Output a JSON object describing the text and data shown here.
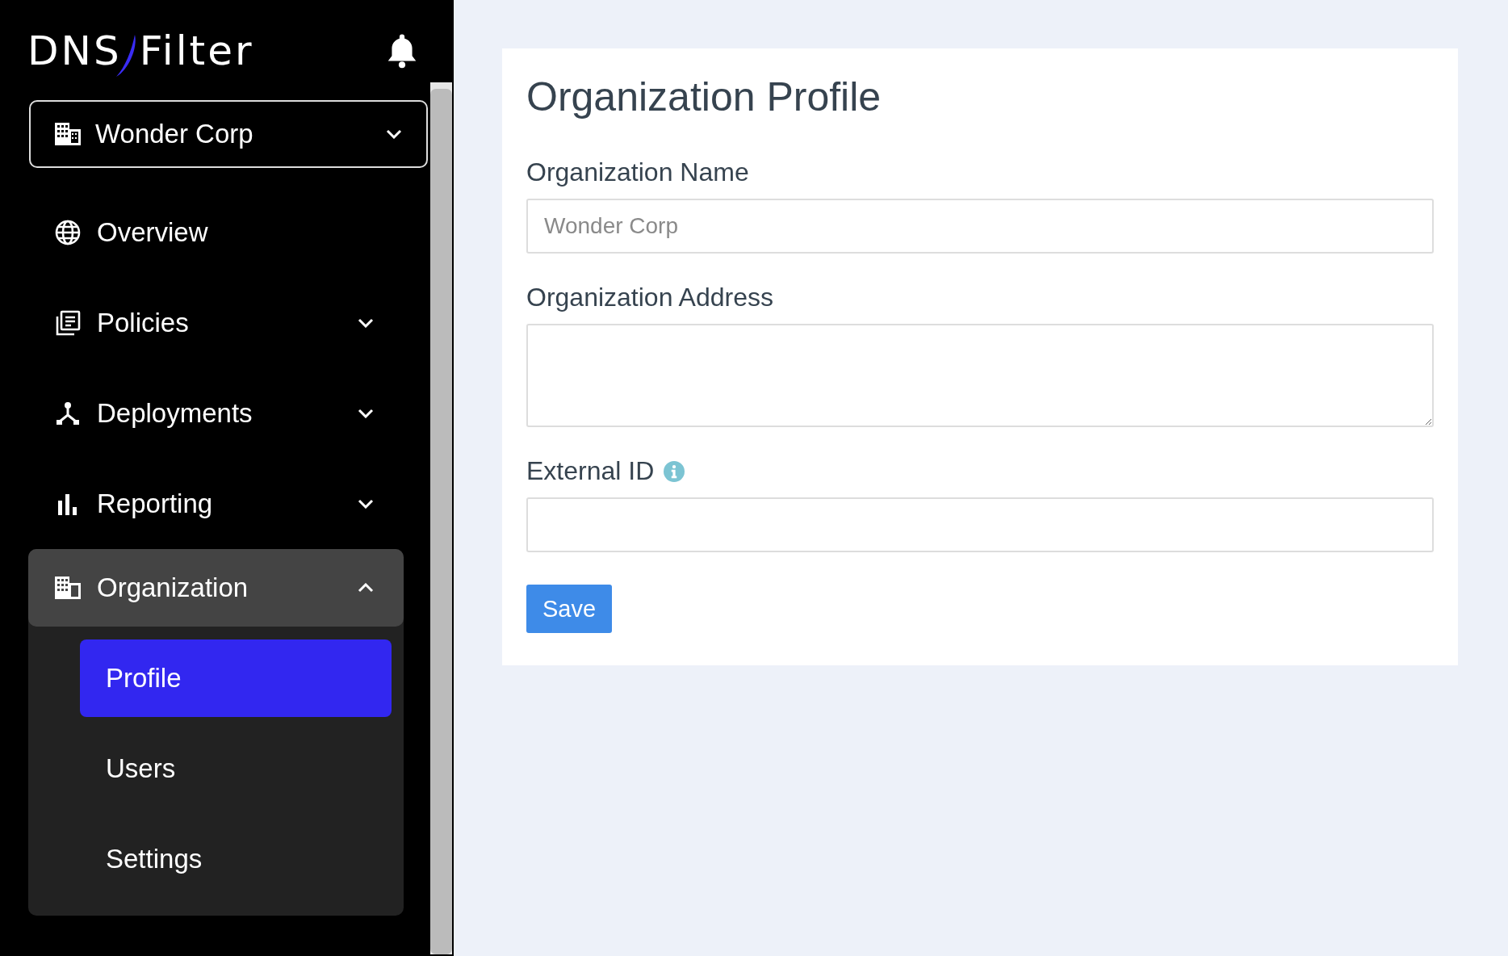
{
  "logo": {
    "part_1": "DNS",
    "part_2": "Filter"
  },
  "org_selector": {
    "value": "Wonder Corp"
  },
  "sidebar": {
    "items": [
      {
        "label": "Overview",
        "expandable": false,
        "expanded": false
      },
      {
        "label": "Policies",
        "expandable": true,
        "expanded": false
      },
      {
        "label": "Deployments",
        "expandable": true,
        "expanded": false
      },
      {
        "label": "Reporting",
        "expandable": true,
        "expanded": false
      },
      {
        "label": "Organization",
        "expandable": true,
        "expanded": true,
        "children": [
          {
            "label": "Profile",
            "selected": true
          },
          {
            "label": "Users",
            "selected": false
          },
          {
            "label": "Settings",
            "selected": false
          }
        ]
      }
    ]
  },
  "form": {
    "title": "Organization Profile",
    "fields": [
      {
        "label": "Organization Name",
        "kind": "input",
        "placeholder": "Wonder Corp"
      },
      {
        "label": "Organization Address",
        "kind": "textarea"
      },
      {
        "label": "External ID",
        "kind": "input",
        "info": true
      }
    ],
    "save_button": "Save"
  }
}
